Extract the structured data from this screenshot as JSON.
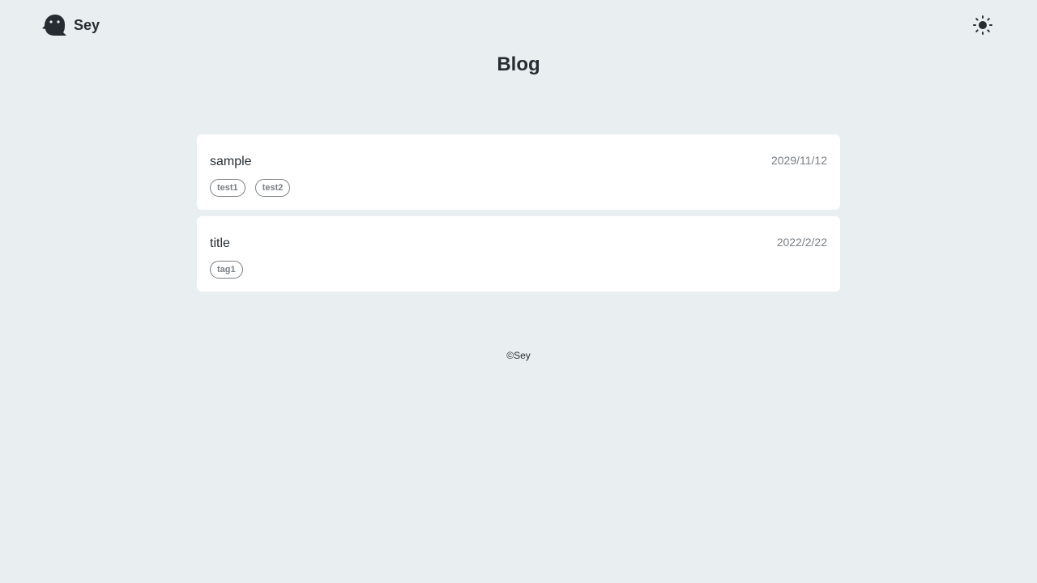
{
  "header": {
    "site_name": "Sey",
    "logo_icon": "ghost-icon",
    "theme_toggle_icon": "sun-icon"
  },
  "page": {
    "title": "Blog"
  },
  "posts": [
    {
      "title": "sample",
      "date": "2029/11/12",
      "tags": [
        "test1",
        "test2"
      ]
    },
    {
      "title": "title",
      "date": "2022/2/22",
      "tags": [
        "tag1"
      ]
    }
  ],
  "footer": {
    "copyright": "©Sey"
  },
  "colors": {
    "background": "#e9eef1",
    "card": "#ffffff",
    "text": "#262c31",
    "muted": "#7a7f84"
  }
}
